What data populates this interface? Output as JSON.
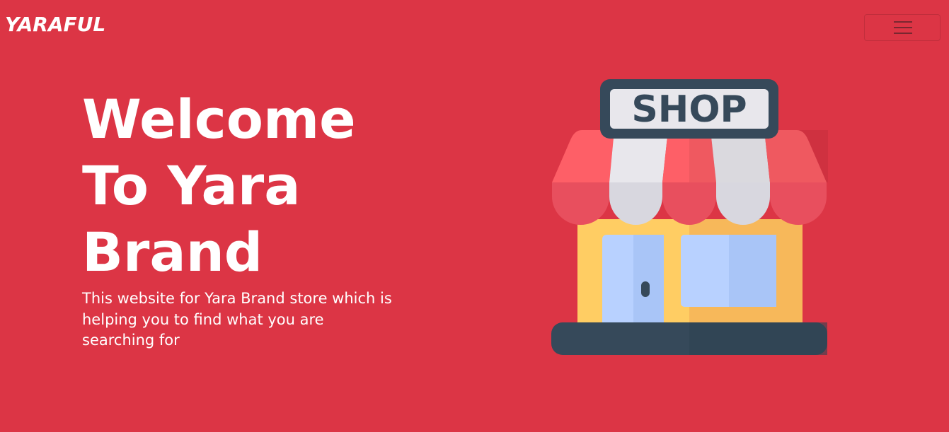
{
  "navbar": {
    "brand": "YARAFUL",
    "toggler_icon": "hamburger-menu-icon"
  },
  "hero": {
    "title": "Welcome To Yara Brand",
    "description": "This website for Yara Brand store which is helping you to find what you are searching for"
  },
  "illustration": {
    "icon": "shop-storefront-icon",
    "sign_text": "SHOP"
  },
  "colors": {
    "background": "#dc3545",
    "text": "#ffffff",
    "awning_red": "#fe5f67",
    "awning_white": "#e8e7ec",
    "wall_yellow": "#ffcd63",
    "window_blue": "#b8d1ff",
    "base_dark": "#36495a"
  }
}
